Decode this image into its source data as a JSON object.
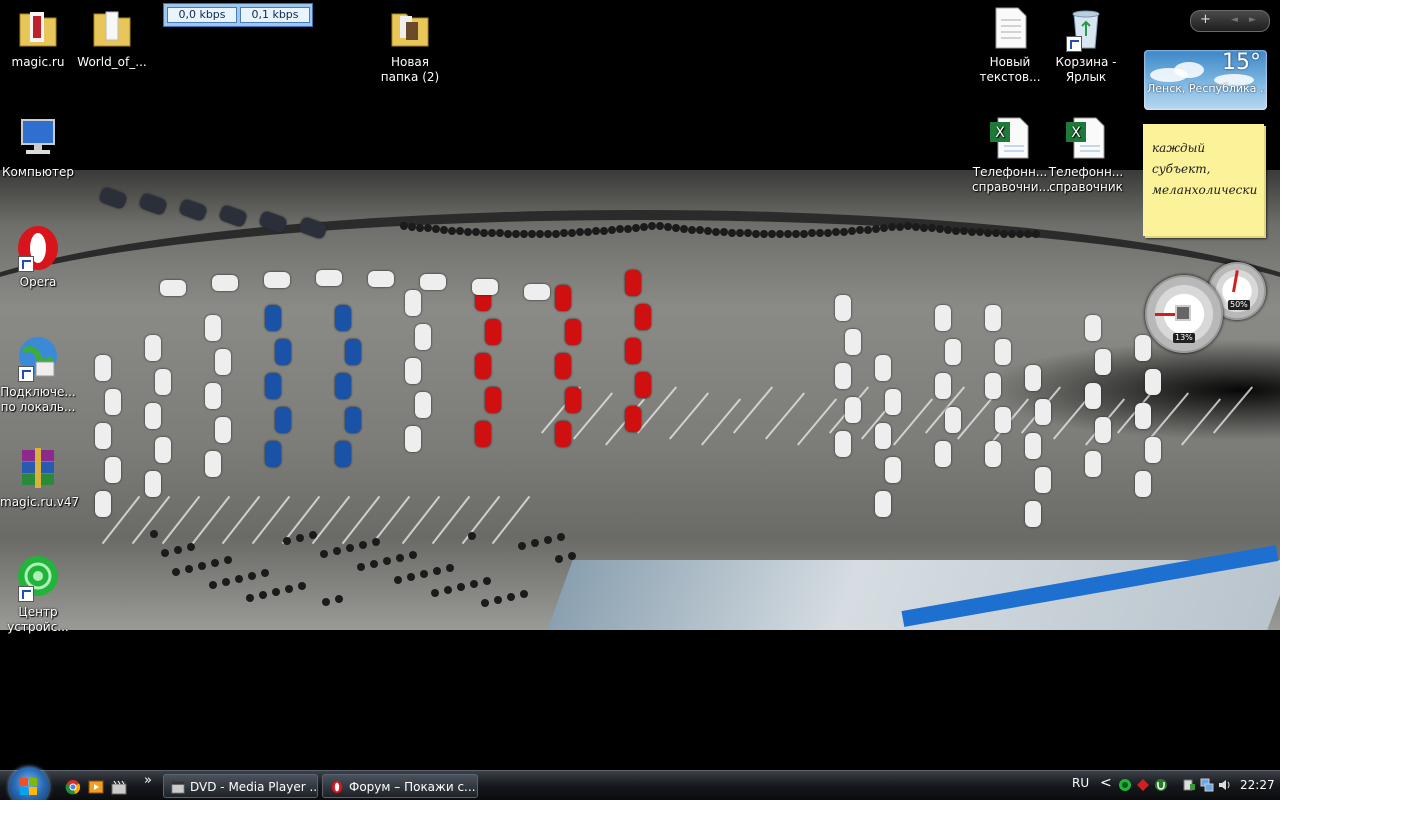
{
  "net_meter": {
    "download": "0,0 kbps",
    "upload": "0,1 kbps"
  },
  "desktop_icons": [
    {
      "label": "magic.ru"
    },
    {
      "label": "World_of_..."
    },
    {
      "label": "Новая папка (2)"
    },
    {
      "label": "Новый текстов..."
    },
    {
      "label": "Корзина - Ярлык"
    },
    {
      "label": "Компьютер"
    },
    {
      "label": "Телефонн... справочни..."
    },
    {
      "label": "Телефонн... справочник"
    },
    {
      "label": "Opera"
    },
    {
      "label": "Подключе... по локаль..."
    },
    {
      "label": "magic.ru.v47"
    },
    {
      "label": "Центр устройс..."
    }
  ],
  "gadgets": {
    "controls": {
      "add": "+",
      "prev": "◄",
      "next": "►"
    },
    "weather": {
      "temperature": "15°",
      "location": "Ленск, Республика ..."
    },
    "note": {
      "text": "каждый субъект, меланхолически"
    },
    "cpu_meter": {
      "cpu": "13%",
      "memory": "50%"
    }
  },
  "taskbar": {
    "overflow": "»",
    "tasks": [
      {
        "label": "DVD - Media Player ..."
      },
      {
        "label": "Форум – Покажи с..."
      }
    ],
    "language": "RU",
    "tray_arrow": "<",
    "clock": "22:27"
  },
  "colors": {
    "taskbar": "#15181c",
    "note": "#fbf29a",
    "weather": "#3d86c8"
  }
}
